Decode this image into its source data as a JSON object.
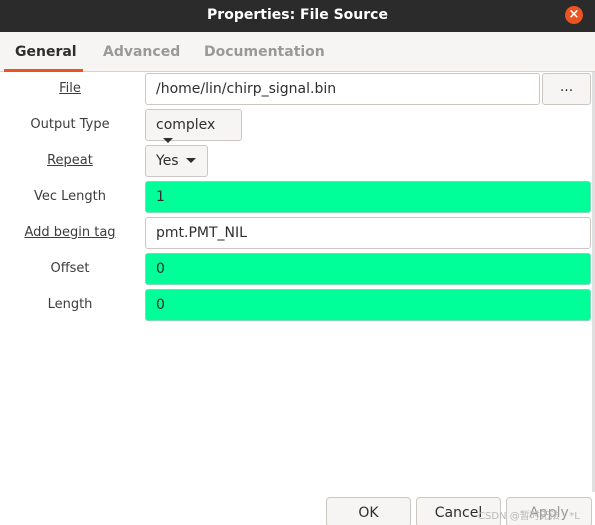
{
  "window": {
    "title": "Properties: File Source",
    "close_icon": "×"
  },
  "tabs": [
    {
      "label": "General",
      "active": true
    },
    {
      "label": "Advanced",
      "active": false
    },
    {
      "label": "Documentation",
      "active": false
    }
  ],
  "params": {
    "file": {
      "label": "File",
      "value": "/home/lin/chirp_signal.bin",
      "browse_label": "..."
    },
    "output_type": {
      "label": "Output Type",
      "value": "complex"
    },
    "repeat": {
      "label": "Repeat",
      "value": "Yes"
    },
    "vec_length": {
      "label": "Vec Length",
      "value": "1"
    },
    "add_begin_tag": {
      "label": "Add begin tag",
      "value": "pmt.PMT_NIL"
    },
    "offset": {
      "label": "Offset",
      "value": "0"
    },
    "length": {
      "label": "Length",
      "value": "0"
    }
  },
  "buttons": {
    "ok": "OK",
    "cancel": "Cancel",
    "apply": "Apply"
  },
  "watermark": "CSDN @暂时无法 · *L",
  "colors": {
    "accent": "#e95420",
    "highlight_field": "#00ff99",
    "titlebar": "#2b2b2b"
  }
}
